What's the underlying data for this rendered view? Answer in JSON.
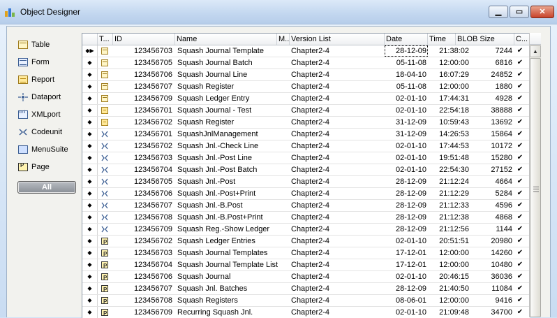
{
  "window": {
    "title": "Object Designer"
  },
  "sidebar": {
    "items": [
      {
        "label": "Table",
        "icon": "table-icon"
      },
      {
        "label": "Form",
        "icon": "form-icon"
      },
      {
        "label": "Report",
        "icon": "report-icon"
      },
      {
        "label": "Dataport",
        "icon": "dataport-icon"
      },
      {
        "label": "XMLport",
        "icon": "xmlport-icon"
      },
      {
        "label": "Codeunit",
        "icon": "codeunit-icon"
      },
      {
        "label": "MenuSuite",
        "icon": "menusuite-icon"
      },
      {
        "label": "Page",
        "icon": "page-icon"
      }
    ],
    "all_label": "All"
  },
  "grid": {
    "headers": {
      "type": "T...",
      "id": "ID",
      "name": "Name",
      "modified": "M...",
      "version": "Version List",
      "date": "Date",
      "time": "Time",
      "blob": "BLOB Size",
      "compiled": "C..."
    },
    "rows": [
      {
        "type": "table",
        "id": "123456703",
        "name": "Squash Journal Template",
        "version": "Chapter2-4",
        "date": "28-12-09",
        "time": "21:38:02",
        "blob": "7244"
      },
      {
        "type": "table",
        "id": "123456705",
        "name": "Squash Journal Batch",
        "version": "Chapter2-4",
        "date": "05-11-08",
        "time": "12:00:00",
        "blob": "6816"
      },
      {
        "type": "table",
        "id": "123456706",
        "name": "Squash Journal Line",
        "version": "Chapter2-4",
        "date": "18-04-10",
        "time": "16:07:29",
        "blob": "24852"
      },
      {
        "type": "table",
        "id": "123456707",
        "name": "Squash Register",
        "version": "Chapter2-4",
        "date": "05-11-08",
        "time": "12:00:00",
        "blob": "1880"
      },
      {
        "type": "table",
        "id": "123456709",
        "name": "Squash Ledger Entry",
        "version": "Chapter2-4",
        "date": "02-01-10",
        "time": "17:44:31",
        "blob": "4928"
      },
      {
        "type": "report",
        "id": "123456701",
        "name": "Squash Journal - Test",
        "version": "Chapter2-4",
        "date": "02-01-10",
        "time": "22:54:18",
        "blob": "38888"
      },
      {
        "type": "report",
        "id": "123456702",
        "name": "Squash Register",
        "version": "Chapter2-4",
        "date": "31-12-09",
        "time": "10:59:43",
        "blob": "13692"
      },
      {
        "type": "codeunit",
        "id": "123456701",
        "name": "SquashJnlManagement",
        "version": "Chapter2-4",
        "date": "31-12-09",
        "time": "14:26:53",
        "blob": "15864"
      },
      {
        "type": "codeunit",
        "id": "123456702",
        "name": "Squash Jnl.-Check Line",
        "version": "Chapter2-4",
        "date": "02-01-10",
        "time": "17:44:53",
        "blob": "10172"
      },
      {
        "type": "codeunit",
        "id": "123456703",
        "name": "Squash Jnl.-Post Line",
        "version": "Chapter2-4",
        "date": "02-01-10",
        "time": "19:51:48",
        "blob": "15280"
      },
      {
        "type": "codeunit",
        "id": "123456704",
        "name": "Squash Jnl.-Post Batch",
        "version": "Chapter2-4",
        "date": "02-01-10",
        "time": "22:54:30",
        "blob": "27152"
      },
      {
        "type": "codeunit",
        "id": "123456705",
        "name": "Squash Jnl.-Post",
        "version": "Chapter2-4",
        "date": "28-12-09",
        "time": "21:12:24",
        "blob": "4664"
      },
      {
        "type": "codeunit",
        "id": "123456706",
        "name": "Squash Jnl.-Post+Print",
        "version": "Chapter2-4",
        "date": "28-12-09",
        "time": "21:12:29",
        "blob": "5284"
      },
      {
        "type": "codeunit",
        "id": "123456707",
        "name": "Squash Jnl.-B.Post",
        "version": "Chapter2-4",
        "date": "28-12-09",
        "time": "21:12:33",
        "blob": "4596"
      },
      {
        "type": "codeunit",
        "id": "123456708",
        "name": "Squash Jnl.-B.Post+Print",
        "version": "Chapter2-4",
        "date": "28-12-09",
        "time": "21:12:38",
        "blob": "4868"
      },
      {
        "type": "codeunit",
        "id": "123456709",
        "name": "Squash Reg.-Show Ledger",
        "version": "Chapter2-4",
        "date": "28-12-09",
        "time": "21:12:56",
        "blob": "1144"
      },
      {
        "type": "page",
        "id": "123456702",
        "name": "Squash Ledger Entries",
        "version": "Chapter2-4",
        "date": "02-01-10",
        "time": "20:51:51",
        "blob": "20980"
      },
      {
        "type": "page",
        "id": "123456703",
        "name": "Squash Journal Templates",
        "version": "Chapter2-4",
        "date": "17-12-01",
        "time": "12:00:00",
        "blob": "14260"
      },
      {
        "type": "page",
        "id": "123456704",
        "name": "Squash Journal Template List",
        "version": "Chapter2-4",
        "date": "17-12-01",
        "time": "12:00:00",
        "blob": "10480"
      },
      {
        "type": "page",
        "id": "123456706",
        "name": "Squash Journal",
        "version": "Chapter2-4",
        "date": "02-01-10",
        "time": "20:46:15",
        "blob": "36036"
      },
      {
        "type": "page",
        "id": "123456707",
        "name": "Squash Jnl. Batches",
        "version": "Chapter2-4",
        "date": "28-12-09",
        "time": "21:40:50",
        "blob": "11084"
      },
      {
        "type": "page",
        "id": "123456708",
        "name": "Squash Registers",
        "version": "Chapter2-4",
        "date": "08-06-01",
        "time": "12:00:00",
        "blob": "9416"
      },
      {
        "type": "page",
        "id": "123456709",
        "name": "Recurring Squash Jnl.",
        "version": "Chapter2-4",
        "date": "02-01-10",
        "time": "21:09:48",
        "blob": "34700"
      }
    ]
  }
}
